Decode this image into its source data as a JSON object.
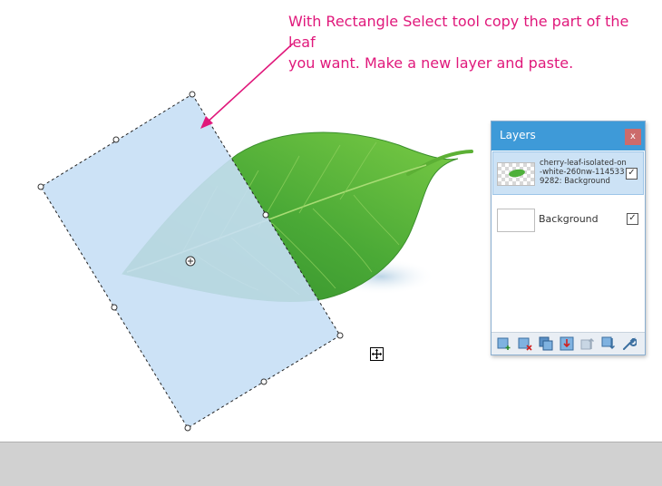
{
  "annotation": {
    "text": "With Rectangle Select tool copy the part of the leaf\nyou want.  Make a new layer and paste.",
    "color": "#e0187b"
  },
  "layers_panel": {
    "title": "Layers",
    "close_label": "x",
    "layers": [
      {
        "name": "cherry-leaf-isolated-on-white-260nw-1145339282: Background",
        "visible": true,
        "selected": true
      },
      {
        "name": "Background",
        "visible": true,
        "selected": false
      }
    ],
    "toolbar": [
      {
        "icon": "add-layer-icon"
      },
      {
        "icon": "delete-layer-icon"
      },
      {
        "icon": "duplicate-layer-icon"
      },
      {
        "icon": "merge-layer-down-icon"
      },
      {
        "icon": "move-layer-up-icon"
      },
      {
        "icon": "move-layer-down-icon"
      },
      {
        "icon": "layer-properties-icon"
      }
    ],
    "check_glyph": "✓"
  },
  "colors": {
    "accent": "#3e9ad8",
    "selection_fill": "#c6dff5",
    "leaf_dark": "#2e8a2a",
    "leaf_light": "#6cc23c"
  }
}
